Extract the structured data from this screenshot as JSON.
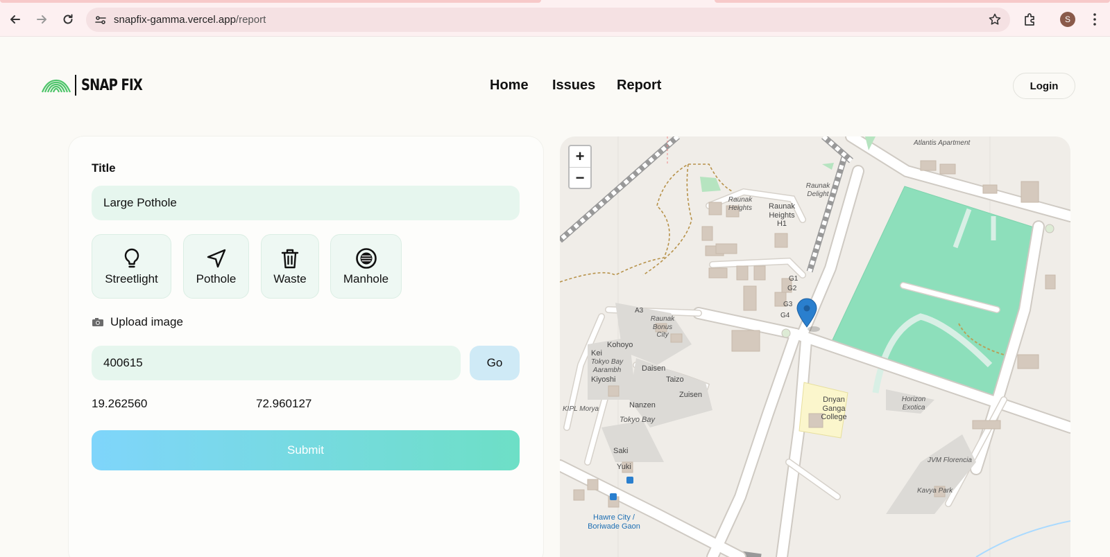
{
  "browser": {
    "url_host": "snapfix-gamma.vercel.app",
    "url_path": "/report",
    "profile_initial": "S"
  },
  "site": {
    "brand": "SNAP FIX",
    "nav": [
      "Home",
      "Issues",
      "Report"
    ],
    "login_label": "Login",
    "brand_color": "#4ec46a"
  },
  "form": {
    "title_label": "Title",
    "title_value": "Large Pothole",
    "categories": [
      {
        "label": "Streetlight",
        "icon": "lightbulb-icon"
      },
      {
        "label": "Pothole",
        "icon": "navigation-arrow-icon"
      },
      {
        "label": "Waste",
        "icon": "trash-icon"
      },
      {
        "label": "Manhole",
        "icon": "manhole-icon"
      }
    ],
    "upload_label": "Upload image",
    "pincode_value": "400615",
    "go_label": "Go",
    "latitude": "19.262560",
    "longitude": "72.960127",
    "submit_label": "Submit"
  },
  "map": {
    "zoom_in": "+",
    "zoom_out": "−",
    "labels": {
      "atlantis": "Atlantis Apartment",
      "raunak_heights_i": "Raunak Heights",
      "raunak_heights_h1": "Raunak Heights H1",
      "raunak_delight": "Raunak Delight",
      "g1": "G1",
      "g2": "G2",
      "g3": "G3",
      "g4": "G4",
      "a3": "A3",
      "raunak_bonus_city": "Raunak Bonus City",
      "kohoyo": "Kohoyo",
      "kei": "Kei",
      "tokyo_bay_aarambh": "Tokyo Bay Aarambh",
      "kiyoshi": "Kiyoshi",
      "daisen": "Daisen",
      "taizo": "Taizo",
      "zuisen": "Zuisen",
      "kipl_morya": "KIPL Morya",
      "nanzen": "Nanzen",
      "tokyo_bay": "Tokyo Bay",
      "saki": "Saki",
      "yuki": "Yuki",
      "dnyan_ganga": "Dnyan Ganga College",
      "horizon_exotica": "Horizon Exotica",
      "jvm_florencia": "JVM Florencia",
      "kavya_park": "Kavya Park",
      "hawre_city": "Hawre City / Boriwade Gaon"
    },
    "park_color": "#8ddfbb",
    "marker_color": "#2a7fce"
  }
}
